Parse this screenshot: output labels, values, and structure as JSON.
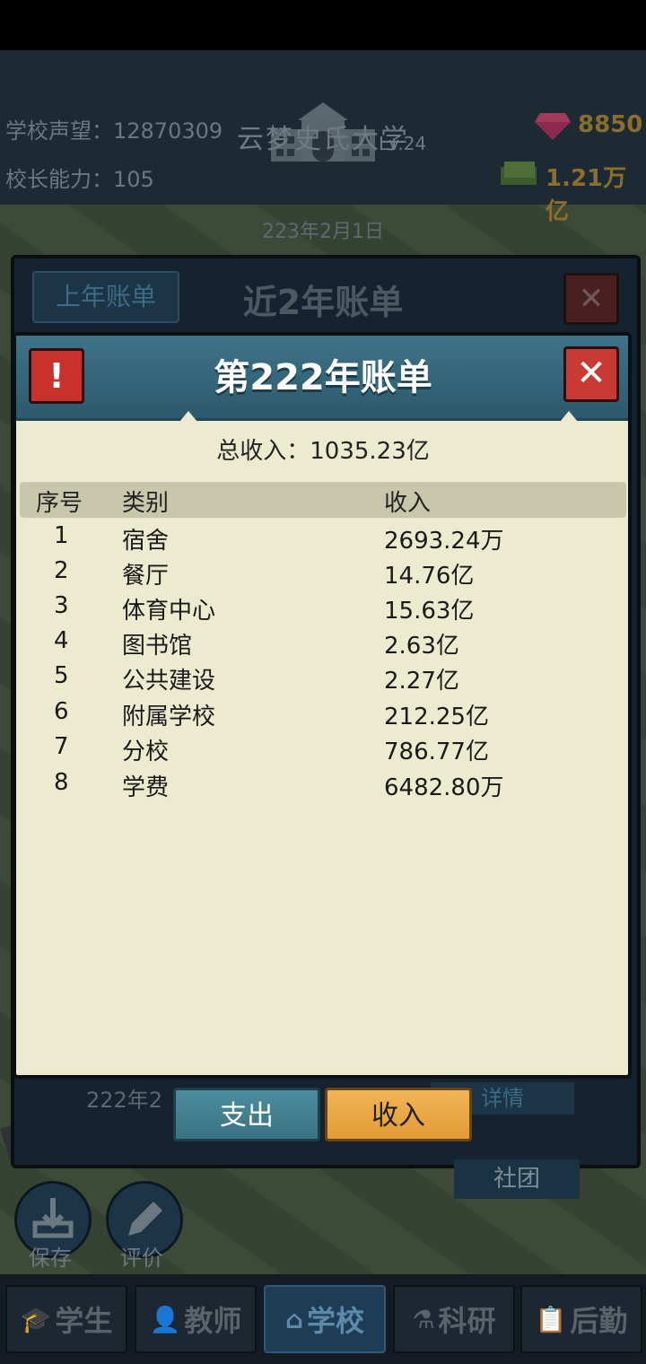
{
  "header": {
    "reputation_label": "学校声望：",
    "reputation_value": "12870309",
    "ability_label": "校长能力：",
    "ability_value": "105",
    "school_name": "云梦史氏大学",
    "school_level": "Lv.24",
    "gems": "8850",
    "money": "1.21万亿",
    "date": "223年2月1日"
  },
  "back_dialog": {
    "tab_last_year": "上年账单",
    "title": "近2年账单",
    "close_glyph": "✕",
    "row_text": "222年2",
    "detail_label": "详情"
  },
  "dialog": {
    "title": "第222年账单",
    "alert_glyph": "!",
    "close_glyph": "✕",
    "total_label": "总收入：1035.23亿",
    "columns": [
      "序号",
      "类别",
      "收入"
    ],
    "rows": [
      {
        "no": "1",
        "category": "宿舍",
        "income": "2693.24万"
      },
      {
        "no": "2",
        "category": "餐厅",
        "income": "14.76亿"
      },
      {
        "no": "3",
        "category": "体育中心",
        "income": "15.63亿"
      },
      {
        "no": "4",
        "category": "图书馆",
        "income": "2.63亿"
      },
      {
        "no": "5",
        "category": "公共建设",
        "income": "2.27亿"
      },
      {
        "no": "6",
        "category": "附属学校",
        "income": "212.25亿"
      },
      {
        "no": "7",
        "category": "分校",
        "income": "786.77亿"
      },
      {
        "no": "8",
        "category": "学费",
        "income": "6482.80万"
      }
    ],
    "tab_expense": "支出",
    "tab_income": "收入"
  },
  "side": {
    "club": "社团",
    "save": "保存",
    "rate": "评价"
  },
  "nav": [
    {
      "label": "学生",
      "icon": "student-icon"
    },
    {
      "label": "教师",
      "icon": "teacher-icon"
    },
    {
      "label": "学校",
      "icon": "school-icon"
    },
    {
      "label": "科研",
      "icon": "research-icon"
    },
    {
      "label": "后勤",
      "icon": "logistics-icon"
    }
  ],
  "colors": {
    "dialog_bg": "#ecebd0",
    "header_teal": "#336478",
    "income_tab": "#e29b35",
    "expense_tab": "#3a7383",
    "close_red": "#c83a33"
  }
}
